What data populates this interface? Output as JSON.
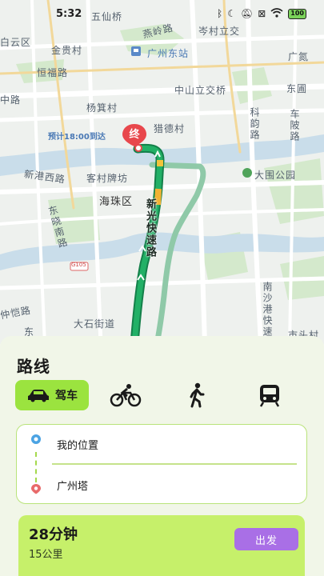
{
  "status_bar": {
    "time": "5:32",
    "icons": [
      "bluetooth-icon",
      "moon-icon",
      "mute-icon",
      "sim-icon",
      "wifi-icon"
    ],
    "battery": "100"
  },
  "map": {
    "labels": [
      {
        "text": "五仙桥"
      },
      {
        "text": "燕岭路"
      },
      {
        "text": "岑村立交"
      },
      {
        "text": "白云区"
      },
      {
        "text": "金贵村"
      },
      {
        "text": "广州东站"
      },
      {
        "text": "广氮"
      },
      {
        "text": "恒福路"
      },
      {
        "text": "中山立交桥"
      },
      {
        "text": "东圃"
      },
      {
        "text": "中路"
      },
      {
        "text": "杨箕村"
      },
      {
        "text": "科韵路"
      },
      {
        "text": "车陂路"
      },
      {
        "text": "猎德村"
      },
      {
        "text": "新港西路"
      },
      {
        "text": "客村牌坊"
      },
      {
        "text": "大围公园"
      },
      {
        "text": "海珠区"
      },
      {
        "text": "东晓南路"
      },
      {
        "text": "仲恺路"
      },
      {
        "text": "大石街道"
      },
      {
        "text": "南沙港快速"
      },
      {
        "text": "市头村"
      },
      {
        "text": "G105"
      },
      {
        "text": "东"
      }
    ],
    "eta": "预计18:00到达",
    "end_marker": "终",
    "road_name": "新光快速路",
    "colors": {
      "route": "#1f9e5c",
      "alt_route": "#8fc9a8",
      "jam": "#f2b233",
      "water": "#c9ddea",
      "park": "#cfe6c6"
    }
  },
  "panel": {
    "title": "路线",
    "modes": [
      {
        "name": "drive",
        "icon": "car-icon",
        "label": "驾车",
        "active": true
      },
      {
        "name": "bike",
        "icon": "bicycle-icon",
        "label": "",
        "active": false
      },
      {
        "name": "walk",
        "icon": "walking-icon",
        "label": "",
        "active": false
      },
      {
        "name": "transit",
        "icon": "train-icon",
        "label": "",
        "active": false
      }
    ],
    "origin": "我的位置",
    "destination": "广州塔",
    "duration": "28分钟",
    "distance": "15公里",
    "go_label": "出发",
    "accent": "#9be33f",
    "button_color": "#a96fe6"
  }
}
